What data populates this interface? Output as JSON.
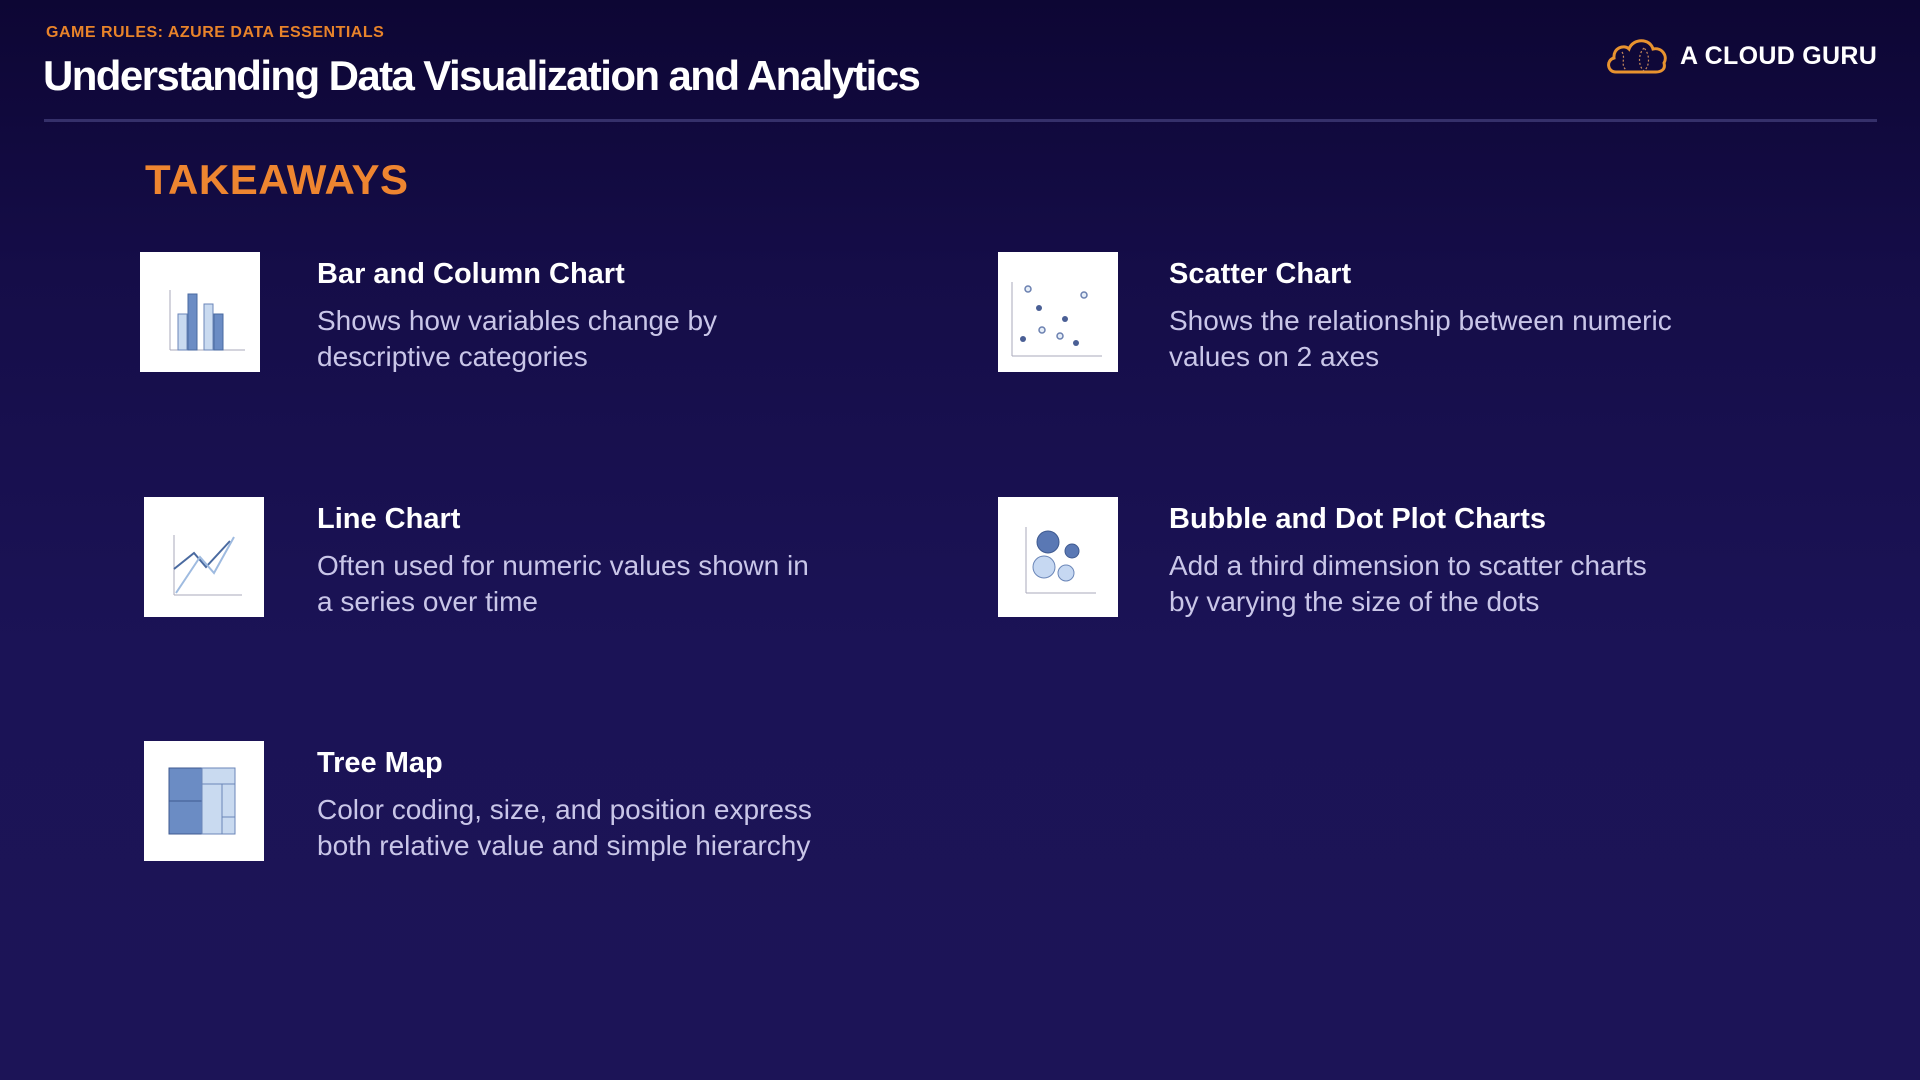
{
  "header": {
    "eyebrow": "GAME RULES: AZURE DATA ESSENTIALS",
    "title": "Understanding Data Visualization and Analytics",
    "logo_text": "A CLOUD GURU"
  },
  "section_title": "TAKEAWAYS",
  "items": [
    {
      "title": "Bar and Column Chart",
      "desc1": "Shows how variables change by",
      "desc2": "descriptive categories",
      "icon": "bar-chart-icon"
    },
    {
      "title": "Scatter Chart",
      "desc1": "Shows the relationship between numeric",
      "desc2": "values on 2 axes",
      "icon": "scatter-chart-icon"
    },
    {
      "title": "Line Chart",
      "desc1": "Often used for numeric values shown in",
      "desc2": "a series over time",
      "icon": "line-chart-icon"
    },
    {
      "title": "Bubble and Dot Plot Charts",
      "desc1": "Add a third dimension to scatter charts",
      "desc2": "by varying the size of the dots",
      "icon": "bubble-chart-icon"
    },
    {
      "title": "Tree Map",
      "desc1": "Color coding, size, and position express",
      "desc2": "both relative value and simple hierarchy",
      "icon": "tree-map-icon"
    }
  ],
  "colors": {
    "accent": "#e8832a",
    "background": "#1b1356"
  }
}
